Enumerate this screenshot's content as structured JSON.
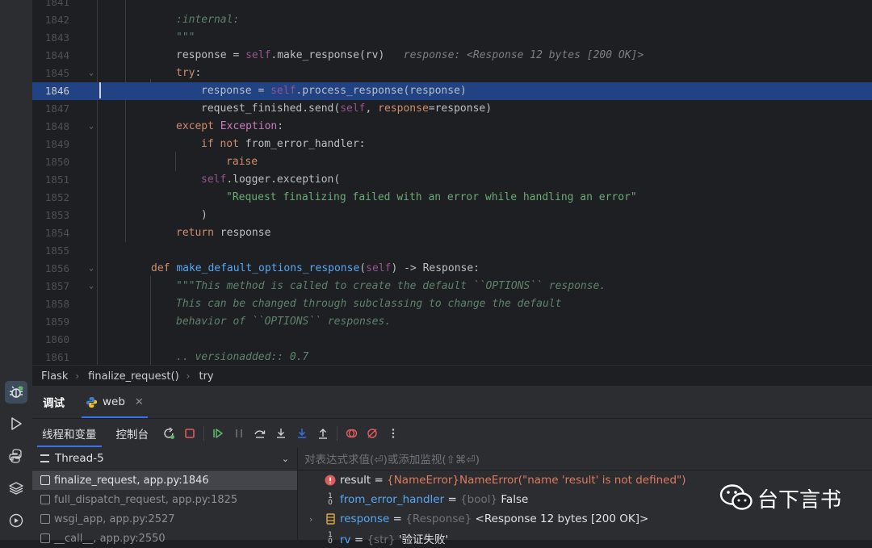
{
  "editor": {
    "lines": [
      {
        "num": "1841",
        "tokens": []
      },
      {
        "num": "1842",
        "tokens": [
          {
            "c": "doc",
            "t": ":internal:"
          }
        ]
      },
      {
        "num": "1843",
        "tokens": [
          {
            "c": "doc",
            "t": "\"\"\""
          }
        ]
      },
      {
        "num": "1844",
        "tokens": [
          {
            "c": "plain",
            "t": "response = "
          },
          {
            "c": "self",
            "t": "self"
          },
          {
            "c": "plain",
            "t": ".make_response(rv)"
          },
          {
            "c": "inl",
            "t": "   response: <Response 12 bytes [200 OK]>"
          }
        ]
      },
      {
        "num": "1845",
        "tokens": [
          {
            "c": "kw",
            "t": "try"
          },
          {
            "c": "plain",
            "t": ":"
          }
        ]
      },
      {
        "num": "1846",
        "tokens": [
          {
            "c": "plain",
            "t": "response = "
          },
          {
            "c": "self",
            "t": "self"
          },
          {
            "c": "plain",
            "t": ".process_response(response)"
          }
        ]
      },
      {
        "num": "1847",
        "tokens": [
          {
            "c": "plain",
            "t": "request_finished.send("
          },
          {
            "c": "self",
            "t": "self"
          },
          {
            "c": "plain",
            "t": ", "
          },
          {
            "c": "param",
            "t": "response"
          },
          {
            "c": "plain",
            "t": "=response)"
          }
        ]
      },
      {
        "num": "1848",
        "tokens": [
          {
            "c": "kw",
            "t": "except "
          },
          {
            "c": "exc",
            "t": "Exception"
          },
          {
            "c": "plain",
            "t": ":"
          }
        ]
      },
      {
        "num": "1849",
        "tokens": [
          {
            "c": "kw",
            "t": "if not "
          },
          {
            "c": "plain",
            "t": "from_error_handler:"
          }
        ]
      },
      {
        "num": "1850",
        "tokens": [
          {
            "c": "kw",
            "t": "raise"
          }
        ]
      },
      {
        "num": "1851",
        "tokens": [
          {
            "c": "self",
            "t": "self"
          },
          {
            "c": "plain",
            "t": ".logger.exception("
          }
        ]
      },
      {
        "num": "1852",
        "tokens": [
          {
            "c": "str",
            "t": "\"Request finalizing failed with an error while handling an error\""
          }
        ]
      },
      {
        "num": "1853",
        "tokens": [
          {
            "c": "plain",
            "t": ")"
          }
        ]
      },
      {
        "num": "1854",
        "tokens": [
          {
            "c": "kw",
            "t": "return "
          },
          {
            "c": "plain",
            "t": "response"
          }
        ]
      },
      {
        "num": "1855",
        "tokens": []
      },
      {
        "num": "1856",
        "tokens": [
          {
            "c": "kw",
            "t": "def "
          },
          {
            "c": "fn",
            "t": "make_default_options_response"
          },
          {
            "c": "plain",
            "t": "("
          },
          {
            "c": "self",
            "t": "self"
          },
          {
            "c": "plain",
            "t": ") -> Response:"
          }
        ]
      },
      {
        "num": "1857",
        "tokens": [
          {
            "c": "doc",
            "t": "\"\"\"This method is called to create the default ``OPTIONS`` response."
          }
        ]
      },
      {
        "num": "1858",
        "tokens": [
          {
            "c": "doc",
            "t": "This can be changed through subclassing to change the default"
          }
        ]
      },
      {
        "num": "1859",
        "tokens": [
          {
            "c": "doc",
            "t": "behavior of ``OPTIONS`` responses."
          }
        ]
      },
      {
        "num": "1860",
        "tokens": []
      },
      {
        "num": "1861",
        "tokens": [
          {
            "c": "doc",
            "t": ".. versionadded:: 0.7"
          }
        ]
      }
    ]
  },
  "breadcrumb": {
    "items": [
      "Flask",
      "finalize_request()",
      "try"
    ]
  },
  "tool_window": {
    "tab_debug": "调试",
    "tab_web": "web",
    "tab_threads": "线程和变量",
    "tab_console": "控制台"
  },
  "frames": {
    "thread": "Thread-5",
    "items": [
      "finalize_request, app.py:1846",
      "full_dispatch_request, app.py:1825",
      "wsgi_app, app.py:2527",
      "__call__, app.py:2550"
    ]
  },
  "variables": {
    "eval_placeholder": "对表达式求值(⏎)或添加监视(⇧⌘⏎)",
    "items": [
      {
        "name": "result",
        "type": "{NameError}",
        "value": "NameError(\"name 'result' is not defined\")"
      },
      {
        "name": "from_error_handler",
        "type": "{bool}",
        "value": "False"
      },
      {
        "name": "response",
        "type": "{Response}",
        "value": "<Response 12 bytes [200 OK]>"
      },
      {
        "name": "rv",
        "type": "{str}",
        "value": "'验证失败'"
      }
    ]
  },
  "watermark": {
    "text": "台下言书"
  },
  "colors": {
    "highlight": "#214283",
    "accent": "#3574f0",
    "error": "#db5c5c"
  }
}
